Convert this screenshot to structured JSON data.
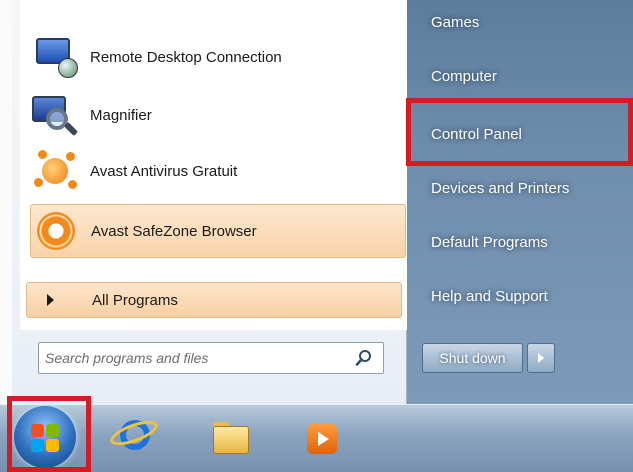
{
  "start_menu": {
    "programs": [
      {
        "label": "Remote Desktop Connection",
        "icon": "remote-desktop-icon"
      },
      {
        "label": "Magnifier",
        "icon": "magnifier-icon"
      },
      {
        "label": "Avast Antivirus Gratuit",
        "icon": "avast-icon"
      },
      {
        "label": "Avast SafeZone Browser",
        "icon": "safezone-icon"
      }
    ],
    "all_programs_label": "All Programs",
    "search": {
      "placeholder": "Search programs and files",
      "value": ""
    },
    "right_items": [
      {
        "label": "Games"
      },
      {
        "label": "Computer"
      },
      {
        "label": "Control Panel"
      },
      {
        "label": "Devices and Printers"
      },
      {
        "label": "Default Programs"
      },
      {
        "label": "Help and Support"
      }
    ],
    "shutdown_label": "Shut down"
  },
  "taskbar": {
    "buttons": [
      "start-orb",
      "internet-explorer-icon",
      "file-explorer-icon",
      "media-player-icon"
    ]
  },
  "colors": {
    "highlight_red": "#d51c24",
    "right_pane": "#6f8eac",
    "taskbar": "#8aa4bf"
  }
}
